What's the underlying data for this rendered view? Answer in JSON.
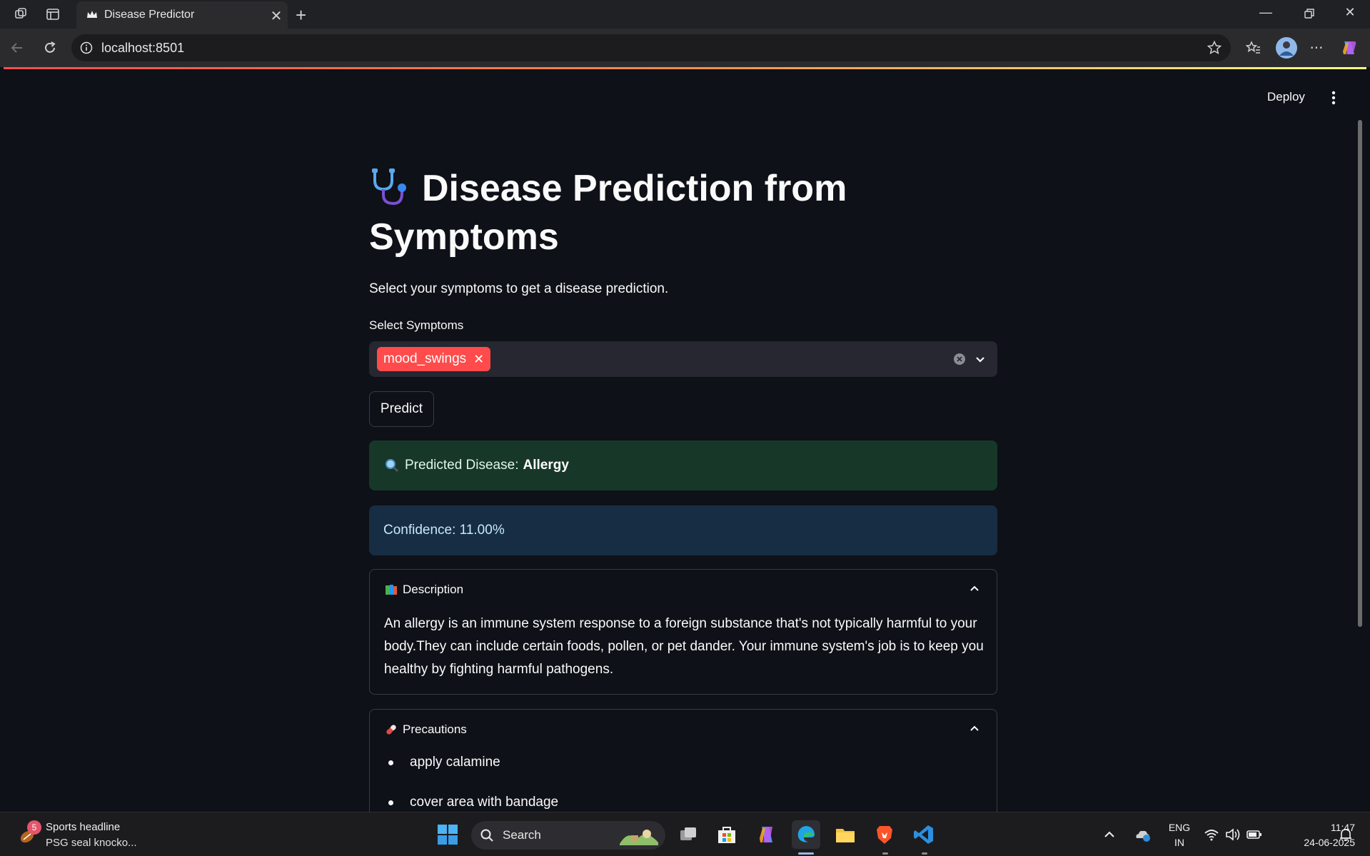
{
  "browser": {
    "tab_title": "Disease Predictor",
    "url": "localhost:8501",
    "new_tab_symbol": "+"
  },
  "app": {
    "header": {
      "deploy_label": "Deploy"
    },
    "title": "Disease Prediction from Symptoms",
    "title_icon": "stethoscope-icon",
    "subtitle": "Select your symptoms to get a disease prediction.",
    "symptoms_label": "Select Symptoms",
    "selected_symptoms": [
      "mood_swings"
    ],
    "predict_label": "Predict",
    "result": {
      "prefix": "Predicted Disease:",
      "disease": "Allergy",
      "confidence": "Confidence: 11.00%"
    },
    "description": {
      "header": "Description",
      "text": "An allergy is an immune system response to a foreign substance that's not typically harmful to your body.They can include certain foods, pollen, or pet dander. Your immune system's job is to keep you healthy by fighting harmful pathogens."
    },
    "precautions": {
      "header": "Precautions",
      "items": [
        "apply calamine",
        "cover area with bandage"
      ]
    }
  },
  "taskbar": {
    "news_badge": "5",
    "news_title": "Sports headline",
    "news_sub": "PSG seal knocko...",
    "search_label": "Search",
    "lang_top": "ENG",
    "lang_bottom": "IN",
    "time": "11:47",
    "date": "24-06-2025"
  },
  "colors": {
    "accent": "#ff4b4b",
    "success_bg": "#173828",
    "info_bg": "#172d43",
    "app_bg": "#0e1117"
  }
}
